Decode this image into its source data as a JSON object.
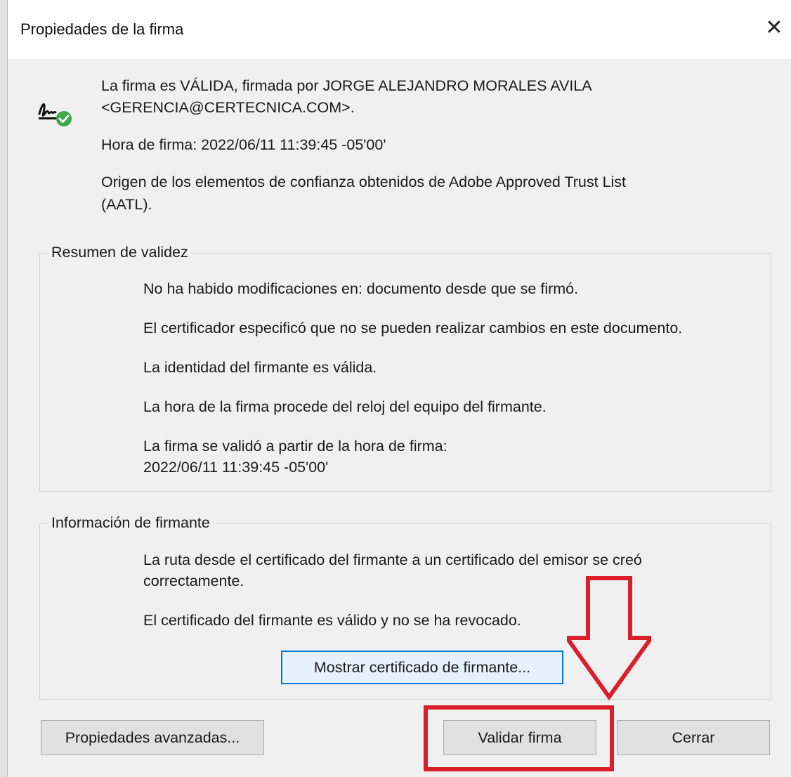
{
  "window": {
    "title": "Propiedades de la firma",
    "close_glyph": "✕"
  },
  "header": {
    "icon": "signature-valid-icon",
    "status_line1": "La firma es VÁLIDA, firmada por JORGE ALEJANDRO MORALES AVILA",
    "status_line2": "<GERENCIA@CERTECNICA.COM>.",
    "signing_time": "Hora de firma:  2022/06/11 11:39:45 -05'00'",
    "trust_line1": "Origen de los elementos de confianza obtenidos de Adobe Approved Trust List",
    "trust_line2": "(AATL)."
  },
  "validity_summary": {
    "legend": "Resumen de validez",
    "items": [
      "No ha habido modificaciones en: documento desde que se firmó.",
      "El certificador especificó que no se pueden realizar cambios en este documento.",
      "La identidad del firmante es válida.",
      "La hora de la firma procede del reloj del equipo del firmante.",
      "La firma se validó a partir de la hora de firma:",
      "2022/06/11 11:39:45 -05'00'"
    ]
  },
  "signer_info": {
    "legend": "Información de firmante",
    "path_line1": "La ruta desde el certificado del firmante a un certificado del emisor se creó",
    "path_line2": "correctamente.",
    "cert_status": "El certificado del firmante es válido y no se ha revocado.",
    "show_cert_button": "Mostrar certificado de firmante..."
  },
  "footer": {
    "advanced_button": "Propiedades avanzadas...",
    "validate_button": "Validar firma",
    "close_button": "Cerrar"
  },
  "colors": {
    "annotation": "#d9202a",
    "check_green": "#3aa845",
    "focus_blue": "#0078d7"
  }
}
